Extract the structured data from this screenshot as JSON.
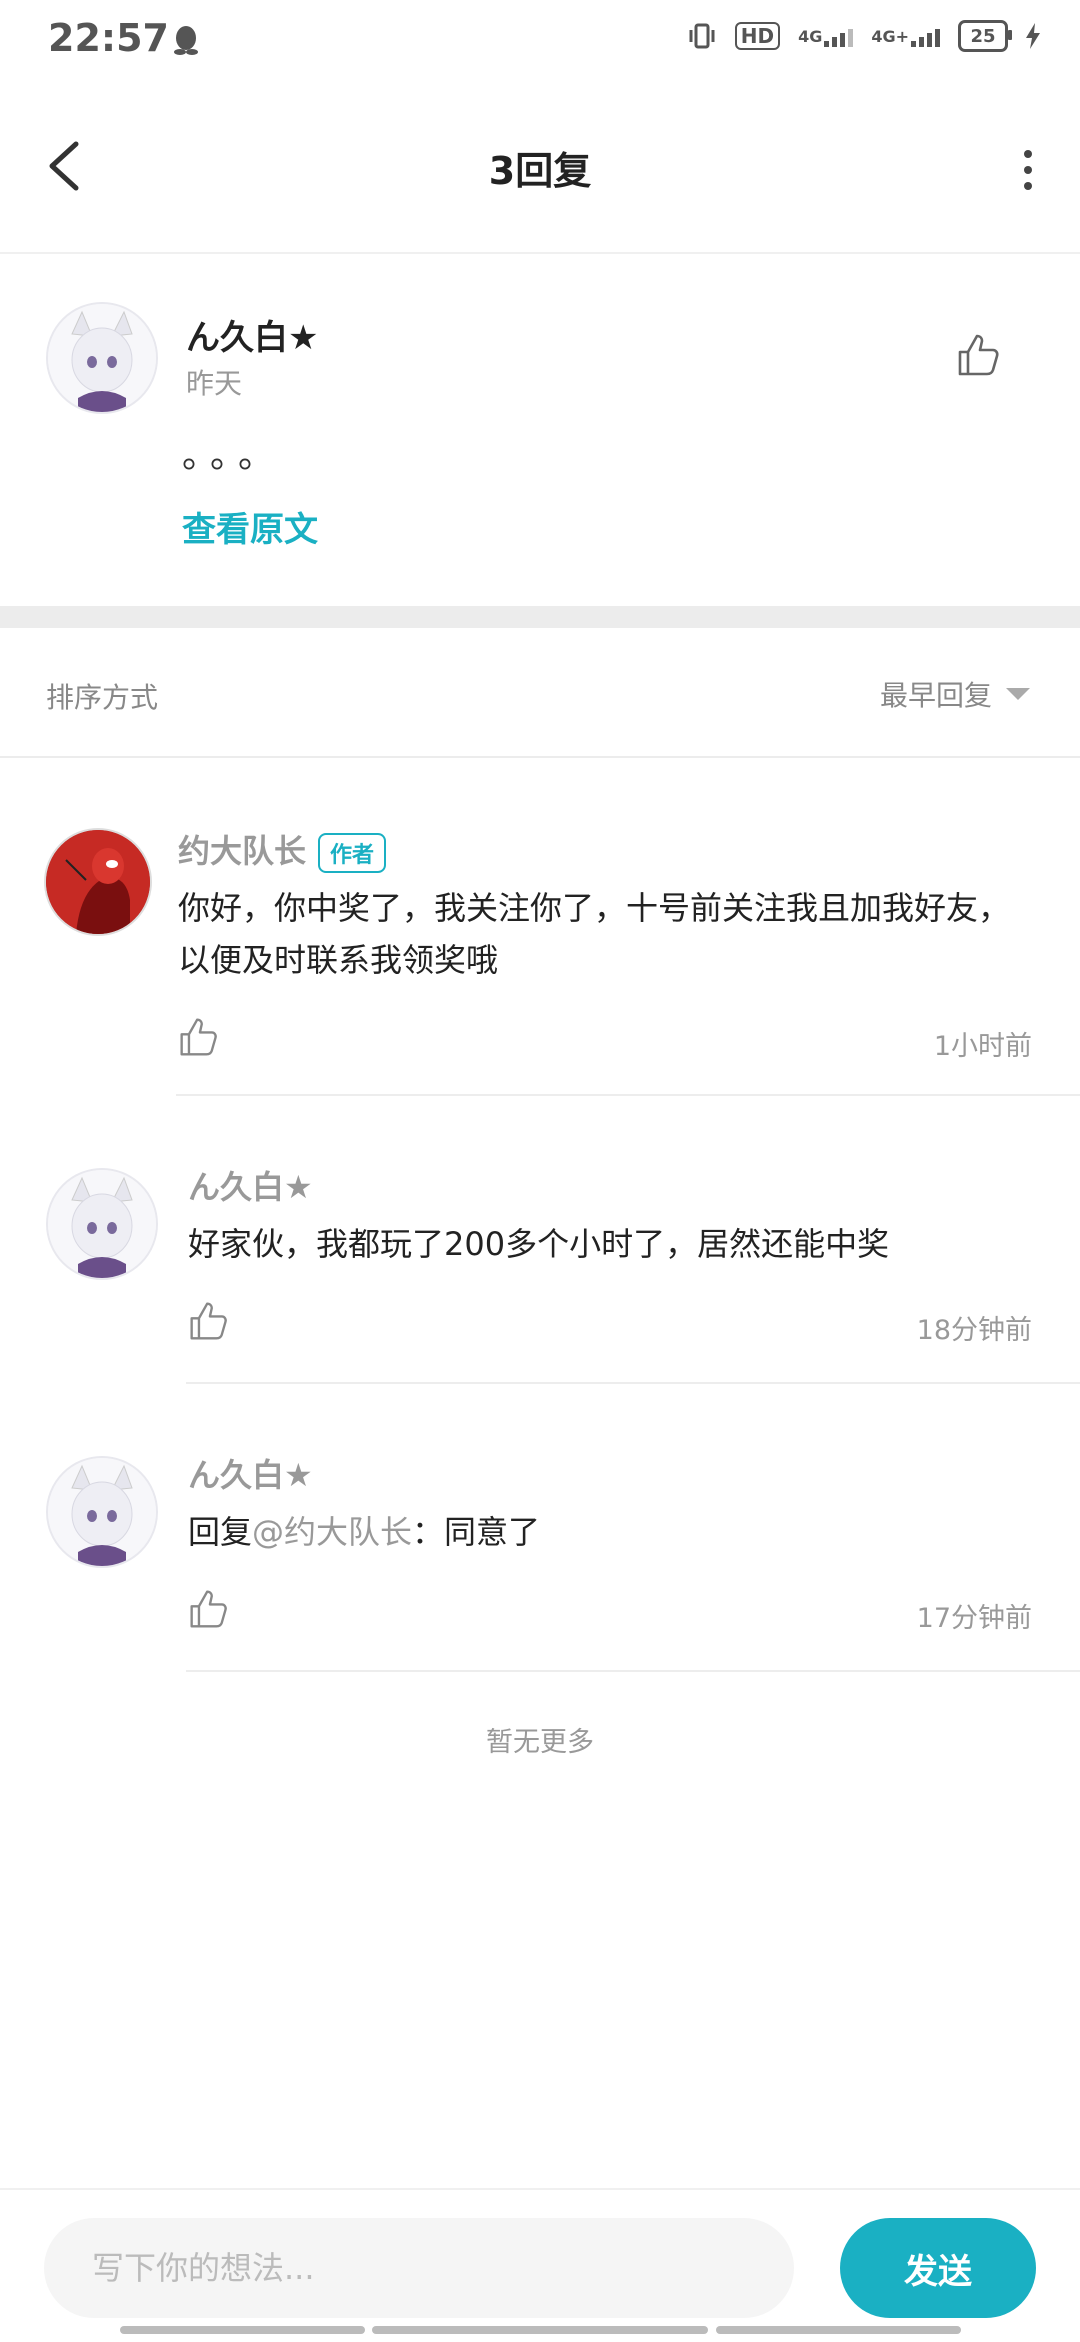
{
  "status_bar": {
    "time": "22:57",
    "hd_label": "HD",
    "net1": "4G",
    "net2": "4G+",
    "battery": "25"
  },
  "header": {
    "title": "3回复"
  },
  "main_comment": {
    "author": "ん久白★",
    "date": "昨天",
    "text": "。。。",
    "view_original": "查看原文"
  },
  "sort": {
    "label": "排序方式",
    "selected": "最早回复"
  },
  "replies": [
    {
      "author": "约大队长",
      "badge": "作者",
      "text": "你好，你中奖了，我关注你了，十号前关注我且加我好友，以便及时联系我领奖哦",
      "time": "1小时前"
    },
    {
      "author": "ん久白★",
      "text": "好家伙，我都玩了200多个小时了，居然还能中奖",
      "time": "18分钟前"
    },
    {
      "author": "ん久白★",
      "reply_prefix": "回复",
      "mention": "@约大队长",
      "text": "：同意了",
      "time": "17分钟前"
    }
  ],
  "footer": {
    "no_more": "暂无更多"
  },
  "input_bar": {
    "placeholder": "写下你的想法...",
    "send_label": "发送"
  },
  "colors": {
    "accent": "#1ab0c3",
    "muted_text": "#999999"
  }
}
